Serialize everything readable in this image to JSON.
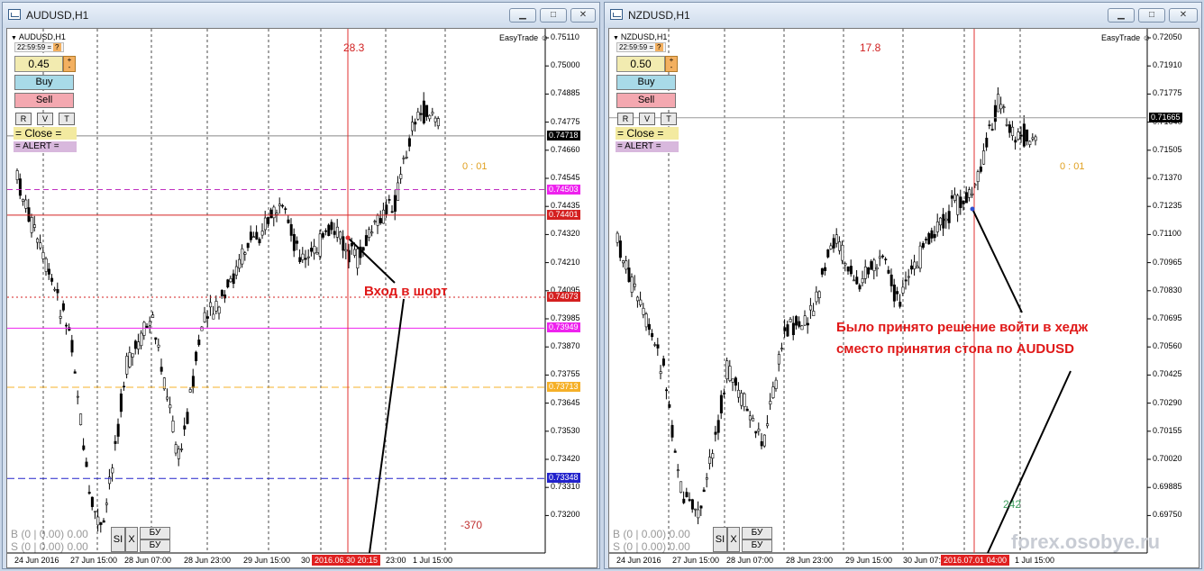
{
  "left": {
    "title": "AUDUSD,H1",
    "symbol": "AUDUSD,H1",
    "server_time": "22:59:59 =",
    "easytrade": "EasyTrade",
    "lot": "0.45",
    "lot_plus": "+",
    "lot_minus": "-",
    "buy": "Buy",
    "sell": "Sell",
    "r": "R",
    "v": "V",
    "t": "T",
    "close": "= Close =",
    "alert": "= ALERT =",
    "b_line": "B (0 | 0.00)  0.00",
    "s_line": "S (0 | 0.00)  0.00",
    "si": "SI",
    "x": "X",
    "buy_ru": "БУ",
    "sell_ru": "БУ",
    "distance": "28.3",
    "timer": "0 : 01",
    "points": "-370",
    "annotation": "Вход в шорт",
    "y_ticks": [
      "0.75110",
      "0.75000",
      "0.74885",
      "0.74775",
      "0.74660",
      "0.74545",
      "0.74435",
      "0.74320",
      "0.74210",
      "0.74095",
      "0.73985",
      "0.73870",
      "0.73755",
      "0.73645",
      "0.73530",
      "0.73420",
      "0.73310",
      "0.73200"
    ],
    "price_labels": [
      {
        "v": "0.74718",
        "bg": "#000000",
        "fg": "#ffffff"
      },
      {
        "v": "0.74503",
        "bg": "#ee22ee",
        "fg": "#ffffff"
      },
      {
        "v": "0.74401",
        "bg": "#d42020",
        "fg": "#ffffff"
      },
      {
        "v": "0.74073",
        "bg": "#d42020",
        "fg": "#ffffff"
      },
      {
        "v": "0.73949",
        "bg": "#ee22ee",
        "fg": "#ffffff"
      },
      {
        "v": "0.73713",
        "bg": "#f5b028",
        "fg": "#ffffff"
      },
      {
        "v": "0.73348",
        "bg": "#2222cc",
        "fg": "#ffffff"
      }
    ],
    "x_ticks": [
      "24 Jun 2016",
      "27 Jun 15:00",
      "28 Jun 07:00",
      "28 Jun 23:00",
      "29 Jun 15:00",
      "30",
      "23:00",
      "1 Jul 15:00"
    ],
    "x_highlight": "2016.06.30 20:15"
  },
  "right": {
    "title": "NZDUSD,H1",
    "symbol": "NZDUSD,H1",
    "server_time": "22:59:59 =",
    "easytrade": "EasyTrade",
    "lot": "0.50",
    "lot_plus": "+",
    "lot_minus": "-",
    "buy": "Buy",
    "sell": "Sell",
    "r": "R",
    "v": "V",
    "t": "T",
    "close": "= Close =",
    "alert": "= ALERT =",
    "b_line": "B (0 | 0.00)  0.00",
    "s_line": "S (0 | 0.00)  0.00",
    "si": "SI",
    "x": "X",
    "buy_ru": "БУ",
    "sell_ru": "БУ",
    "distance": "17.8",
    "timer": "0 : 01",
    "points": "242",
    "annotation_1": "Было принято решение войти в хедж",
    "annotation_2": "сместо принятия стопа по  AUDUSD",
    "watermark": "forex.osobye.ru",
    "y_ticks": [
      "0.72050",
      "0.71910",
      "0.71775",
      "0.71640",
      "0.71505",
      "0.71370",
      "0.71235",
      "0.71100",
      "0.70965",
      "0.70830",
      "0.70695",
      "0.70560",
      "0.70425",
      "0.70290",
      "0.70155",
      "0.70020",
      "0.69885",
      "0.69750"
    ],
    "price_labels": [
      {
        "v": "0.71665",
        "bg": "#000000",
        "fg": "#ffffff"
      }
    ],
    "x_ticks": [
      "24 Jun 2016",
      "27 Jun 15:00",
      "28 Jun 07:00",
      "28 Jun 23:00",
      "29 Jun 15:00",
      "30 Jun 07:00",
      "",
      "1 Jul 15:00"
    ],
    "x_highlight": "2016.07.01 04:00"
  }
}
